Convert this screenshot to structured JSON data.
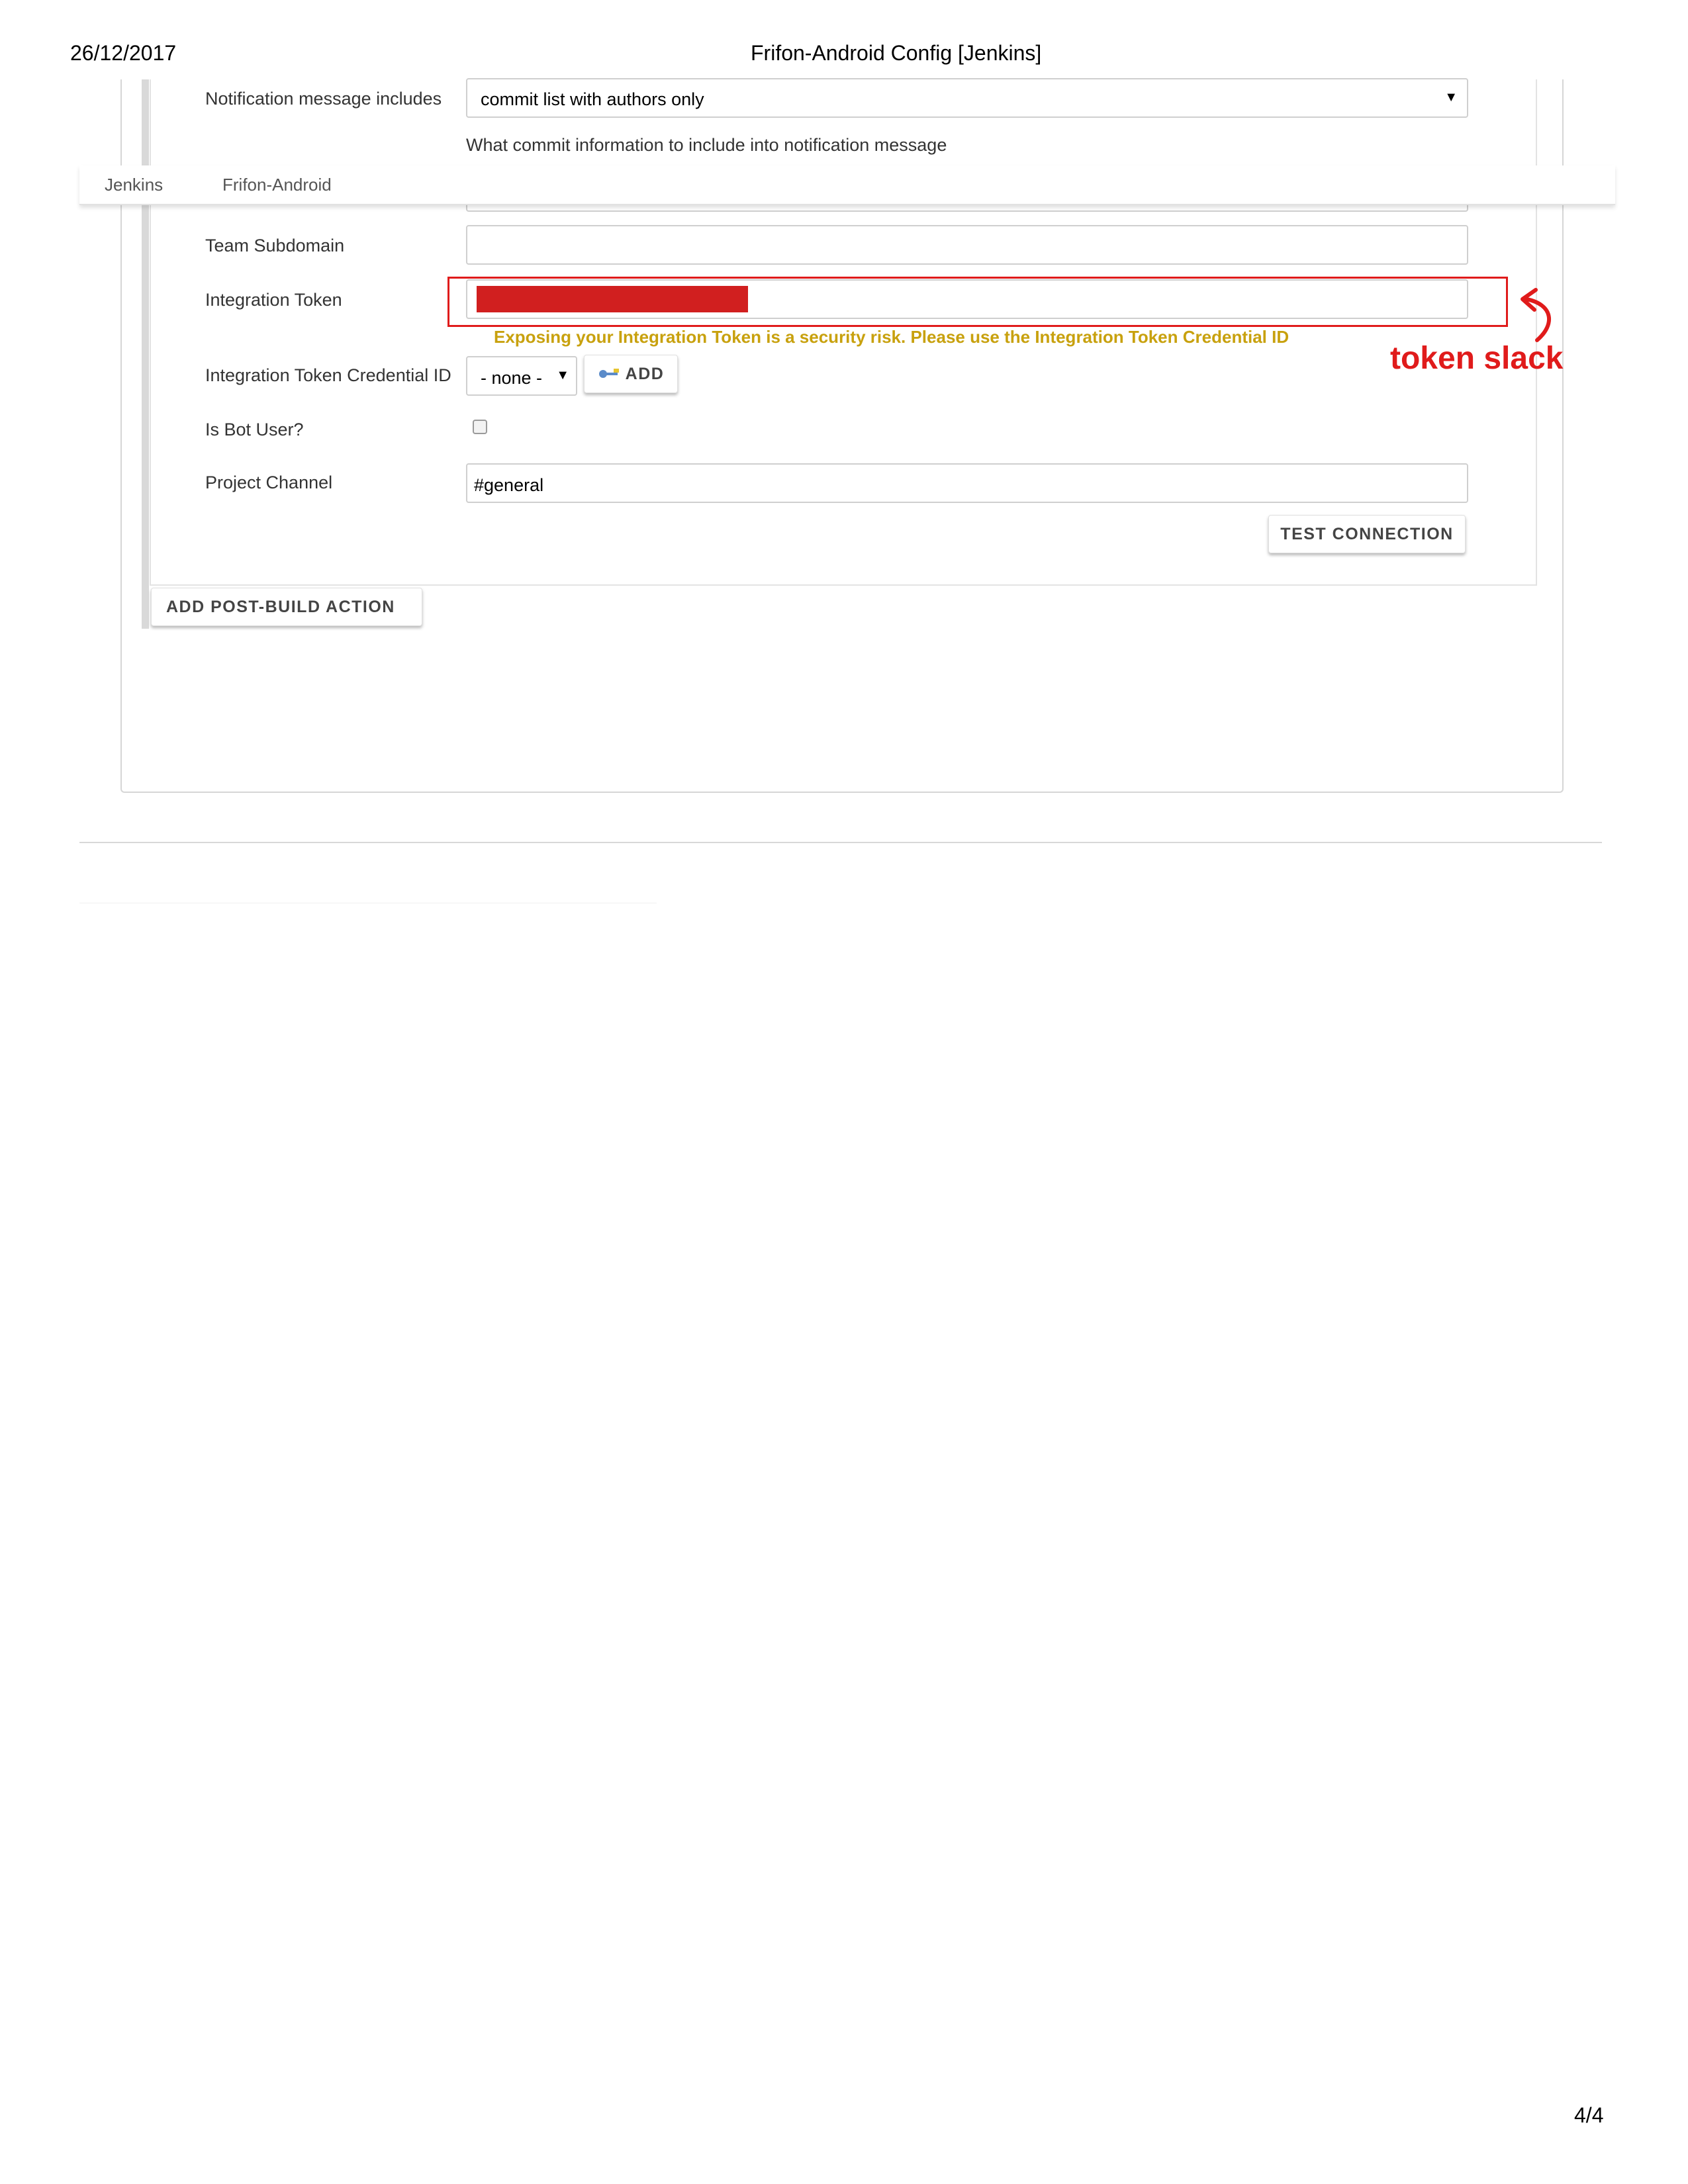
{
  "print_header": {
    "date": "26/12/2017",
    "title": "Frifon-Android Config [Jenkins]",
    "page_number": "4/4"
  },
  "breadcrumb": {
    "items": [
      "Jenkins",
      "Frifon-Android"
    ]
  },
  "form": {
    "notification": {
      "label": "Notification message includes",
      "selected": "commit list with authors only",
      "help": "What commit information to include into notification message"
    },
    "team_subdomain": {
      "label": "Team Subdomain",
      "value": ""
    },
    "integration_token": {
      "label": "Integration Token",
      "warning": "Exposing your Integration Token is a security risk. Please use the Integration Token Credential ID"
    },
    "credential_id": {
      "label": "Integration Token Credential ID",
      "selected": "- none -",
      "add_label": "ADD"
    },
    "bot_user": {
      "label": "Is Bot User?",
      "checked": false
    },
    "project_channel": {
      "label": "Project Channel",
      "value": "#general"
    },
    "test_connection_label": "TEST CONNECTION",
    "add_post_build_label": "ADD POST-BUILD ACTION"
  },
  "annotation": {
    "text": "token slack",
    "color": "#e01b1b"
  },
  "colors": {
    "warning": "#c8a10e",
    "redaction": "#d11f1f"
  }
}
